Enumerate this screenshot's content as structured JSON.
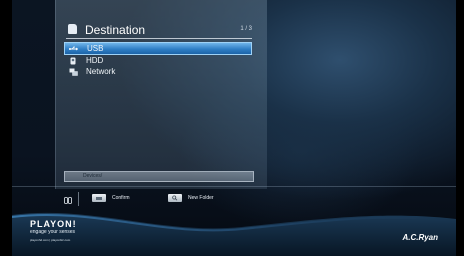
{
  "panel": {
    "title": "Destination",
    "page": "1 / 3",
    "items": [
      {
        "label": "USB",
        "icon": "usb-icon",
        "selected": true
      },
      {
        "label": "HDD",
        "icon": "hdd-icon",
        "selected": false
      },
      {
        "label": "Network",
        "icon": "network-icon",
        "selected": false
      }
    ],
    "path": "Devices/"
  },
  "buttons": {
    "confirm_label": "Confirm",
    "confirm_icon": "ok-key-icon",
    "new_folder_label": "New Folder",
    "new_folder_icon": "search-key-icon"
  },
  "brand": {
    "logo_main": "PLAYON!",
    "tagline": "engage your senses",
    "urls": "playonhd.com | playonbiz.com",
    "maker": "A.C.Ryan"
  },
  "colors": {
    "accent_selection": "#2f7fc6",
    "logo_accent": "#f2c21b"
  }
}
